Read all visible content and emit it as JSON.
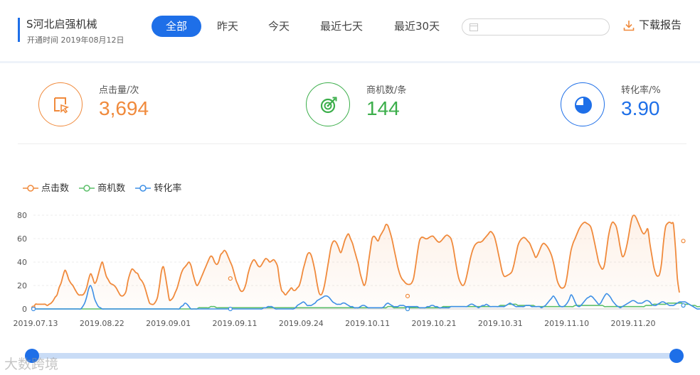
{
  "header": {
    "company": "S河北启强机械",
    "open_date": "开通时间 2019年08月12日",
    "tabs": [
      {
        "label": "全部",
        "active": true
      },
      {
        "label": "昨天",
        "active": false
      },
      {
        "label": "今天",
        "active": false
      },
      {
        "label": "最近七天",
        "active": false
      },
      {
        "label": "最近30天",
        "active": false
      }
    ],
    "date_range_value": "",
    "download_label": "下载报告"
  },
  "stats": [
    {
      "label": "点击量/次",
      "value": "3,694",
      "icon": "click-icon",
      "color": "#f08a3c"
    },
    {
      "label": "商机数/条",
      "value": "144",
      "icon": "target-icon",
      "color": "#3bae4a"
    },
    {
      "label": "转化率/%",
      "value": "3.90",
      "icon": "pie-icon",
      "color": "#1e6fe8"
    }
  ],
  "colors": {
    "accent": "#1e6fe8",
    "clicks": "#f08a3c",
    "leads": "#5cbf6a",
    "conversion": "#3d8fe6"
  },
  "watermark": "大数跨境",
  "chart_data": {
    "type": "line",
    "x_tick_labels": [
      "2019.07.13",
      "2019.08.22",
      "2019.09.01",
      "2019.09.11",
      "2019.09.24",
      "2019.10.11",
      "2019.10.21",
      "2019.10.31",
      "2019.11.10",
      "2019.11.20"
    ],
    "ylim": [
      0,
      80
    ],
    "yticks": [
      0,
      20,
      40,
      60,
      80
    ],
    "legend_position": "top-left",
    "grid": true,
    "series": [
      {
        "name": "点击数",
        "color": "#f08a3c",
        "area": true,
        "values": [
          1,
          4,
          4,
          4,
          4,
          4,
          4,
          3,
          4,
          5,
          7,
          10,
          12,
          18,
          22,
          28,
          33,
          30,
          25,
          22,
          20,
          17,
          14,
          12,
          12,
          12,
          14,
          18,
          25,
          30,
          27,
          22,
          24,
          30,
          36,
          40,
          34,
          28,
          25,
          22,
          21,
          20,
          18,
          15,
          12,
          11,
          12,
          15,
          24,
          30,
          34,
          33,
          31,
          30,
          26,
          24,
          21,
          16,
          10,
          5,
          4,
          4,
          6,
          10,
          20,
          32,
          36,
          28,
          18,
          8,
          8,
          10,
          14,
          18,
          24,
          30,
          34,
          36,
          38,
          40,
          37,
          30,
          24,
          20,
          22,
          26,
          30,
          34,
          38,
          42,
          45,
          44,
          40,
          38,
          40,
          46,
          48,
          50,
          48,
          44,
          40,
          36,
          30,
          24,
          20,
          16,
          15,
          17,
          22,
          30,
          36,
          40,
          42,
          40,
          37,
          36,
          38,
          41,
          43,
          42,
          40,
          41,
          42,
          40,
          36,
          24,
          16,
          14,
          12,
          14,
          16,
          18,
          16,
          16,
          18,
          20,
          26,
          34,
          40,
          46,
          48,
          46,
          40,
          32,
          22,
          14,
          12,
          15,
          22,
          32,
          42,
          52,
          57,
          58,
          56,
          52,
          48,
          52,
          58,
          62,
          64,
          60,
          56,
          50,
          44,
          38,
          30,
          24,
          20,
          25,
          38,
          50,
          60,
          62,
          60,
          58,
          62,
          65,
          68,
          72,
          71,
          66,
          60,
          52,
          44,
          36,
          30,
          26,
          24,
          22,
          21,
          21,
          22,
          26,
          36,
          48,
          58,
          61,
          61,
          60,
          60,
          61,
          62,
          62,
          60,
          58,
          57,
          58,
          60,
          62,
          63,
          62,
          60,
          54,
          44,
          34,
          26,
          22,
          20,
          22,
          28,
          36,
          44,
          50,
          54,
          56,
          57,
          57,
          58,
          60,
          62,
          64,
          66,
          65,
          62,
          56,
          48,
          40,
          32,
          28,
          28,
          29,
          30,
          32,
          38,
          46,
          54,
          58,
          60,
          61,
          60,
          58,
          56,
          52,
          48,
          44,
          46,
          50,
          54,
          56,
          55,
          53,
          50,
          46,
          40,
          32,
          24,
          20,
          18,
          18,
          20,
          28,
          40,
          50,
          56,
          60,
          64,
          68,
          71,
          73,
          74,
          73,
          72,
          70,
          64,
          56,
          48,
          40,
          36,
          34,
          38,
          50,
          62,
          70,
          74,
          73,
          70,
          62,
          52,
          45,
          46,
          52,
          60,
          70,
          78,
          80,
          78,
          74,
          70,
          66,
          64,
          66,
          68,
          56,
          46,
          36,
          30,
          28,
          30,
          40,
          58,
          70,
          73,
          74,
          73,
          72,
          52,
          26,
          14
        ]
      },
      {
        "name": "商机数",
        "color": "#5cbf6a",
        "area": false,
        "values": [
          0,
          0,
          0,
          0,
          0,
          0,
          0,
          0,
          0,
          0,
          0,
          0,
          0,
          0,
          0,
          0,
          0,
          0,
          0,
          0,
          0,
          0,
          0,
          0,
          0,
          0,
          0,
          0,
          0,
          0,
          0,
          0,
          0,
          0,
          0,
          0,
          0,
          0,
          0,
          0,
          0,
          0,
          0,
          0,
          0,
          0,
          0,
          0,
          0,
          0,
          0,
          0,
          0,
          0,
          0,
          0,
          0,
          0,
          0,
          0,
          0,
          0,
          0,
          0,
          0,
          0,
          0,
          0,
          0,
          0,
          0,
          0,
          0,
          0,
          0,
          0,
          0,
          0,
          0,
          0,
          0,
          0,
          0,
          0,
          1,
          1,
          1,
          1,
          1,
          1,
          2,
          2,
          2,
          1,
          1,
          1,
          1,
          1,
          1,
          1,
          1,
          1,
          1,
          1,
          1,
          1,
          1,
          1,
          1,
          1,
          1,
          1,
          1,
          1,
          1,
          1,
          1,
          1,
          1,
          1,
          1,
          1,
          1,
          1,
          1,
          1,
          1,
          1,
          1,
          1,
          1,
          1,
          1,
          1,
          1,
          1,
          1,
          1,
          1,
          1,
          1,
          1,
          1,
          1,
          1,
          1,
          1,
          1,
          1,
          1,
          1,
          1,
          1,
          1,
          1,
          1,
          1,
          1,
          1,
          1,
          1,
          1,
          1,
          1,
          1,
          1,
          1,
          1,
          1,
          1,
          1,
          1,
          1,
          1,
          1,
          1,
          1,
          1,
          1,
          1,
          2,
          2,
          2,
          1,
          1,
          1,
          1,
          1,
          1,
          1,
          1,
          1,
          1,
          1,
          1,
          1,
          1,
          1,
          1,
          1,
          1,
          1,
          1,
          1,
          1,
          1,
          1,
          1,
          2,
          2,
          2,
          2,
          2,
          2,
          2,
          2,
          2,
          2,
          2,
          2,
          2,
          2,
          2,
          2,
          2,
          2,
          2,
          2,
          2,
          2,
          2,
          2,
          2,
          2,
          2,
          2,
          2,
          3,
          3,
          3,
          3,
          4,
          4,
          4,
          4,
          4,
          3,
          3,
          3,
          3,
          3,
          3,
          3,
          3,
          3,
          2,
          2,
          2,
          2,
          2,
          2,
          2,
          2,
          2,
          2,
          2,
          2,
          2,
          2,
          2,
          2,
          2,
          2,
          2,
          2,
          3,
          3,
          3,
          3,
          3,
          3,
          3,
          3,
          3,
          3,
          3,
          3,
          3,
          3,
          3,
          2,
          2,
          2,
          2,
          2,
          2,
          2,
          2,
          2,
          2,
          2,
          2,
          2,
          2,
          2,
          2,
          2,
          2,
          2,
          2,
          2,
          3,
          3,
          3,
          3,
          4,
          4,
          4,
          4,
          4,
          4,
          4,
          5,
          5,
          5,
          5,
          5,
          5,
          5,
          5,
          4,
          4,
          4,
          4,
          3,
          3,
          3,
          2,
          2,
          2,
          1,
          1,
          1,
          1,
          1,
          2,
          2,
          2
        ]
      },
      {
        "name": "转化率",
        "color": "#3d8fe6",
        "area": false,
        "values": [
          0,
          0,
          0,
          0,
          0,
          0,
          0,
          0,
          0,
          0,
          0,
          0,
          0,
          0,
          0,
          0,
          0,
          0,
          0,
          0,
          0,
          0,
          0,
          0,
          0,
          2,
          5,
          10,
          17,
          20,
          16,
          9,
          5,
          2,
          1,
          0,
          0,
          0,
          0,
          0,
          0,
          0,
          0,
          0,
          0,
          0,
          0,
          0,
          0,
          0,
          0,
          0,
          0,
          0,
          0,
          0,
          0,
          0,
          0,
          0,
          0,
          0,
          0,
          0,
          0,
          0,
          0,
          0,
          0,
          0,
          0,
          0,
          0,
          0,
          0,
          2,
          3,
          5,
          4,
          2,
          0,
          0,
          0,
          0,
          0,
          0,
          0,
          0,
          0,
          0,
          0,
          0,
          0,
          0,
          0,
          0,
          0,
          0,
          0,
          0,
          0,
          0,
          0,
          0,
          0,
          0,
          0,
          0,
          0,
          0,
          0,
          0,
          0,
          0,
          0,
          0,
          0,
          1,
          1,
          2,
          2,
          2,
          1,
          0,
          0,
          0,
          0,
          0,
          0,
          0,
          0,
          0,
          0,
          1,
          3,
          4,
          5,
          6,
          5,
          3,
          3,
          3,
          4,
          5,
          7,
          8,
          9,
          10,
          11,
          11,
          10,
          8,
          6,
          5,
          4,
          4,
          4,
          5,
          5,
          4,
          3,
          2,
          2,
          1,
          1,
          1,
          2,
          3,
          3,
          2,
          1,
          1,
          1,
          1,
          1,
          1,
          1,
          1,
          2,
          4,
          5,
          4,
          3,
          2,
          2,
          2,
          3,
          3,
          3,
          2,
          2,
          2,
          2,
          2,
          2,
          2,
          1,
          1,
          1,
          1,
          2,
          2,
          3,
          3,
          2,
          2,
          1,
          1,
          1,
          1,
          1,
          1,
          2,
          2,
          2,
          2,
          2,
          2,
          2,
          2,
          2,
          3,
          4,
          4,
          3,
          2,
          1,
          2,
          3,
          3,
          4,
          3,
          2,
          2,
          2,
          2,
          2,
          2,
          2,
          2,
          3,
          4,
          5,
          4,
          3,
          2,
          2,
          2,
          2,
          2,
          3,
          3,
          3,
          2,
          2,
          2,
          2,
          2,
          1,
          2,
          3,
          5,
          7,
          9,
          11,
          9,
          6,
          3,
          2,
          2,
          3,
          5,
          8,
          12,
          10,
          6,
          3,
          2,
          3,
          5,
          7,
          9,
          10,
          11,
          10,
          8,
          6,
          4,
          5,
          8,
          11,
          13,
          12,
          10,
          7,
          5,
          3,
          2,
          1,
          2,
          3,
          4,
          5,
          6,
          7,
          7,
          6,
          5,
          5,
          5,
          6,
          7,
          7,
          6,
          4,
          3,
          3,
          4,
          5,
          6,
          6,
          5,
          4,
          3,
          3,
          3,
          4,
          5,
          6,
          6,
          6,
          6,
          5,
          4,
          3,
          2,
          1,
          0,
          0,
          0,
          0,
          0,
          0,
          0,
          0,
          0,
          1,
          3,
          8,
          13
        ]
      }
    ],
    "markers": {
      "点击数": [
        [
          0,
          1
        ],
        [
          100,
          26
        ],
        [
          190,
          11
        ],
        [
          330,
          58
        ]
      ],
      "商机数": [
        [
          190,
          0
        ],
        [
          330,
          3
        ]
      ],
      "转化率": [
        [
          0,
          0
        ],
        [
          100,
          0
        ],
        [
          190,
          0
        ],
        [
          330,
          3
        ]
      ]
    }
  }
}
